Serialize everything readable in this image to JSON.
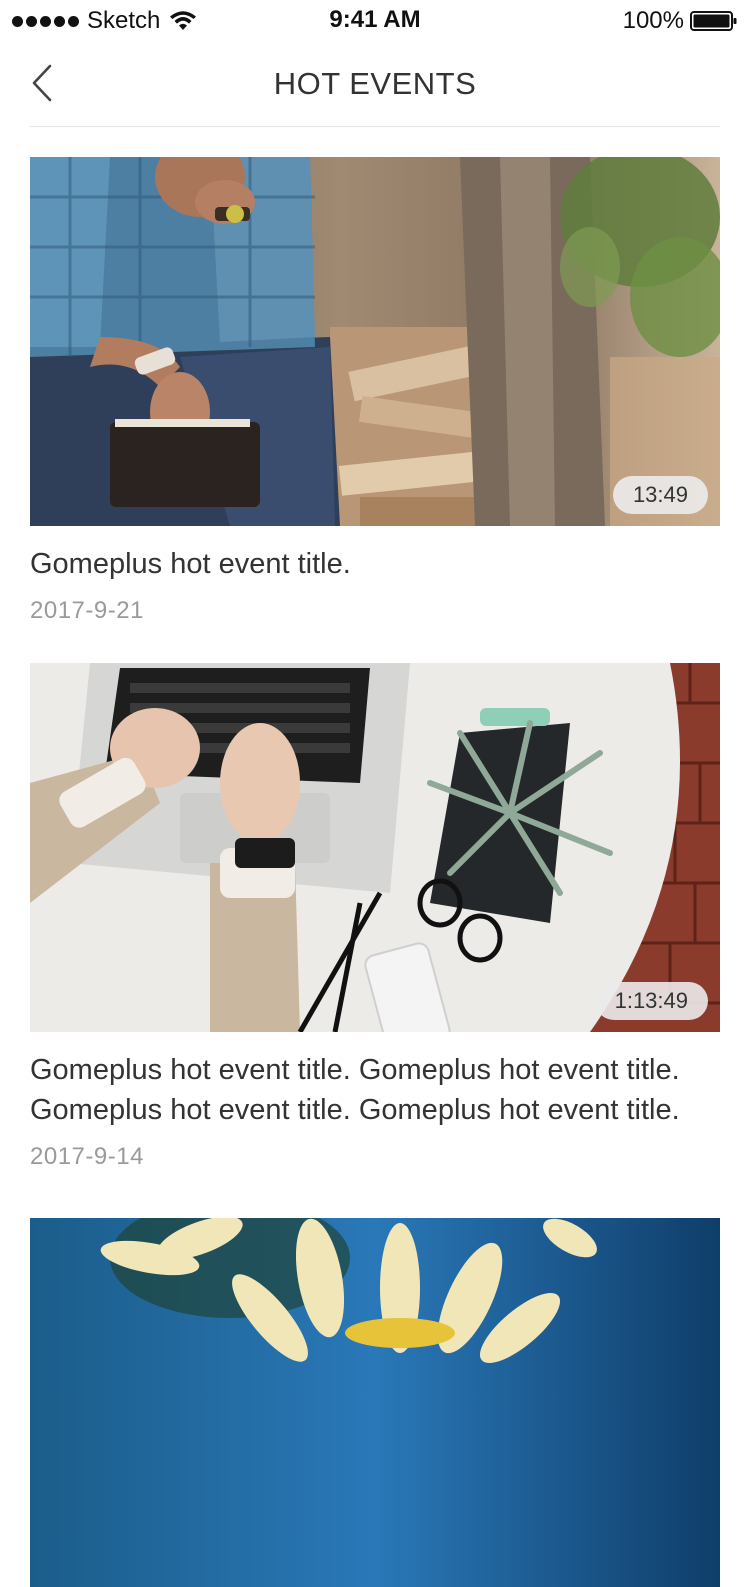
{
  "status_bar": {
    "carrier": "Sketch",
    "time": "9:41 AM",
    "battery": "100%"
  },
  "nav": {
    "title": "HOT EVENTS",
    "back_icon": "chevron-left-icon"
  },
  "events": [
    {
      "title": "Gomeplus hot event title.",
      "date": "2017-9-21",
      "duration": "13:49"
    },
    {
      "title": "Gomeplus hot event title. Gomeplus hot event title. Gomeplus hot event title. Gomeplus hot event title.",
      "date": "2017-9-14",
      "duration": "1:13:49"
    },
    {
      "title": "",
      "date": "",
      "duration": ""
    }
  ],
  "colors": {
    "text": "#333333",
    "date": "#9a9a9a",
    "divider": "#e5e5e5"
  }
}
